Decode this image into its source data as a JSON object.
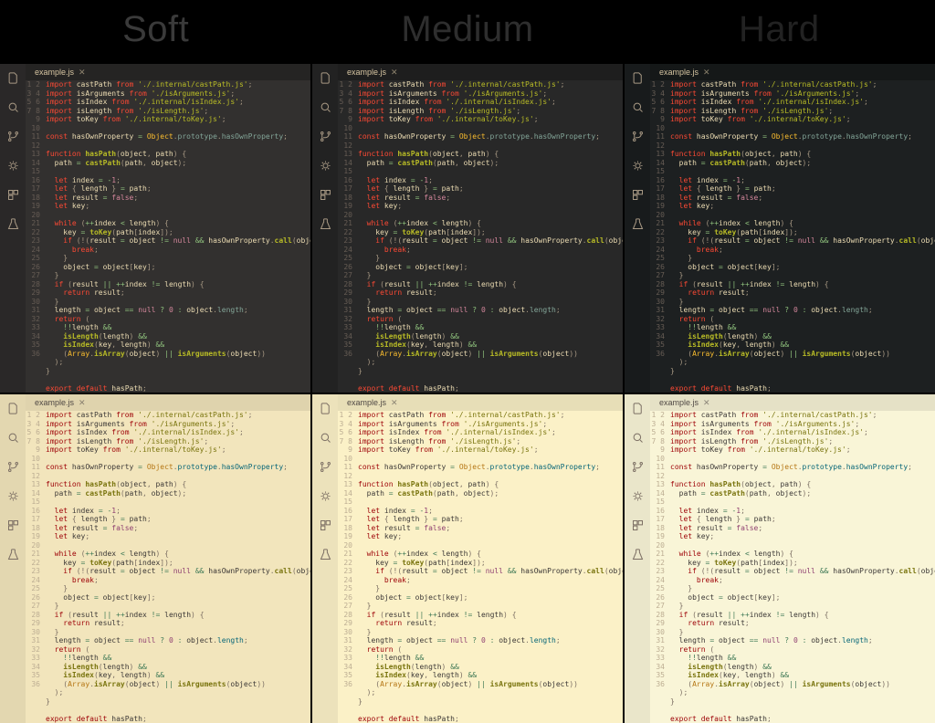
{
  "headings": {
    "soft": "Soft",
    "medium": "Medium",
    "hard": "Hard"
  },
  "tab": {
    "filename": "example.js",
    "close": "✕"
  },
  "icons": [
    "files",
    "search",
    "git-branch",
    "debug",
    "extensions",
    "testing"
  ],
  "code_lines": [
    {
      "n": 1,
      "t": [
        [
          "kw",
          "import"
        ],
        [
          "txt",
          " castPath "
        ],
        [
          "kw",
          "from"
        ],
        [
          "txt",
          " "
        ],
        [
          "str",
          "'./.internal/castPath.js'"
        ],
        [
          "pun",
          ";"
        ]
      ]
    },
    {
      "n": 2,
      "t": [
        [
          "kw",
          "import"
        ],
        [
          "txt",
          " isArguments "
        ],
        [
          "kw",
          "from"
        ],
        [
          "txt",
          " "
        ],
        [
          "str",
          "'./isArguments.js'"
        ],
        [
          "pun",
          ";"
        ]
      ]
    },
    {
      "n": 3,
      "t": [
        [
          "kw",
          "import"
        ],
        [
          "txt",
          " isIndex "
        ],
        [
          "kw",
          "from"
        ],
        [
          "txt",
          " "
        ],
        [
          "str",
          "'./.internal/isIndex.js'"
        ],
        [
          "pun",
          ";"
        ]
      ]
    },
    {
      "n": 4,
      "t": [
        [
          "kw",
          "import"
        ],
        [
          "txt",
          " isLength "
        ],
        [
          "kw",
          "from"
        ],
        [
          "txt",
          " "
        ],
        [
          "str",
          "'./isLength.js'"
        ],
        [
          "pun",
          ";"
        ]
      ]
    },
    {
      "n": 5,
      "t": [
        [
          "kw",
          "import"
        ],
        [
          "txt",
          " toKey "
        ],
        [
          "kw",
          "from"
        ],
        [
          "txt",
          " "
        ],
        [
          "str",
          "'./.internal/toKey.js'"
        ],
        [
          "pun",
          ";"
        ]
      ]
    },
    {
      "n": 6,
      "t": []
    },
    {
      "n": 7,
      "t": [
        [
          "kw",
          "const"
        ],
        [
          "txt",
          " hasOwnProperty "
        ],
        [
          "op",
          "="
        ],
        [
          "txt",
          " "
        ],
        [
          "obj",
          "Object"
        ],
        [
          "pun",
          "."
        ],
        [
          "blue",
          "prototype"
        ],
        [
          "pun",
          "."
        ],
        [
          "blue",
          "hasOwnProperty"
        ],
        [
          "pun",
          ";"
        ]
      ]
    },
    {
      "n": 8,
      "t": []
    },
    {
      "n": 9,
      "t": [
        [
          "kw",
          "function"
        ],
        [
          "txt",
          " "
        ],
        [
          "fn",
          "hasPath"
        ],
        [
          "pun",
          "("
        ],
        [
          "txt",
          "object"
        ],
        [
          "pun",
          ","
        ],
        [
          "txt",
          " path"
        ],
        [
          "pun",
          ")"
        ],
        [
          "txt",
          " "
        ],
        [
          "pun",
          "{"
        ]
      ]
    },
    {
      "n": 10,
      "t": [
        [
          "txt",
          "  path "
        ],
        [
          "op",
          "="
        ],
        [
          "txt",
          " "
        ],
        [
          "fn",
          "castPath"
        ],
        [
          "pun",
          "("
        ],
        [
          "txt",
          "path"
        ],
        [
          "pun",
          ","
        ],
        [
          "txt",
          " object"
        ],
        [
          "pun",
          ");"
        ]
      ]
    },
    {
      "n": 11,
      "t": []
    },
    {
      "n": 12,
      "t": [
        [
          "txt",
          "  "
        ],
        [
          "kw",
          "let"
        ],
        [
          "txt",
          " index "
        ],
        [
          "op",
          "="
        ],
        [
          "txt",
          " "
        ],
        [
          "op",
          "-"
        ],
        [
          "num",
          "1"
        ],
        [
          "pun",
          ";"
        ]
      ]
    },
    {
      "n": 13,
      "t": [
        [
          "txt",
          "  "
        ],
        [
          "kw",
          "let"
        ],
        [
          "txt",
          " "
        ],
        [
          "pun",
          "{"
        ],
        [
          "txt",
          " length "
        ],
        [
          "pun",
          "}"
        ],
        [
          "txt",
          " "
        ],
        [
          "op",
          "="
        ],
        [
          "txt",
          " path"
        ],
        [
          "pun",
          ";"
        ]
      ]
    },
    {
      "n": 14,
      "t": [
        [
          "txt",
          "  "
        ],
        [
          "kw",
          "let"
        ],
        [
          "txt",
          " result "
        ],
        [
          "op",
          "="
        ],
        [
          "txt",
          " "
        ],
        [
          "val",
          "false"
        ],
        [
          "pun",
          ";"
        ]
      ]
    },
    {
      "n": 15,
      "t": [
        [
          "txt",
          "  "
        ],
        [
          "kw",
          "let"
        ],
        [
          "txt",
          " key"
        ],
        [
          "pun",
          ";"
        ]
      ]
    },
    {
      "n": 16,
      "t": []
    },
    {
      "n": 17,
      "t": [
        [
          "txt",
          "  "
        ],
        [
          "kw",
          "while"
        ],
        [
          "txt",
          " "
        ],
        [
          "pun",
          "("
        ],
        [
          "op",
          "++"
        ],
        [
          "txt",
          "index "
        ],
        [
          "op",
          "<"
        ],
        [
          "txt",
          " length"
        ],
        [
          "pun",
          ")"
        ],
        [
          "txt",
          " "
        ],
        [
          "pun",
          "{"
        ]
      ]
    },
    {
      "n": 18,
      "t": [
        [
          "txt",
          "    key "
        ],
        [
          "op",
          "="
        ],
        [
          "txt",
          " "
        ],
        [
          "fn",
          "toKey"
        ],
        [
          "pun",
          "("
        ],
        [
          "txt",
          "path"
        ],
        [
          "pun",
          "["
        ],
        [
          "txt",
          "index"
        ],
        [
          "pun",
          "]);"
        ]
      ]
    },
    {
      "n": 19,
      "t": [
        [
          "txt",
          "    "
        ],
        [
          "kw",
          "if"
        ],
        [
          "txt",
          " "
        ],
        [
          "pun",
          "(!("
        ],
        [
          "txt",
          "result "
        ],
        [
          "op",
          "="
        ],
        [
          "txt",
          " object "
        ],
        [
          "op",
          "!="
        ],
        [
          "txt",
          " "
        ],
        [
          "val",
          "null"
        ],
        [
          "txt",
          " "
        ],
        [
          "op",
          "&&"
        ],
        [
          "txt",
          " hasOwnProperty"
        ],
        [
          "pun",
          "."
        ],
        [
          "fn",
          "call"
        ],
        [
          "pun",
          "("
        ],
        [
          "txt",
          "object"
        ],
        [
          "pun",
          ","
        ],
        [
          "txt",
          " key"
        ],
        [
          "pun",
          ")))"
        ],
        [
          "txt",
          " "
        ],
        [
          "pun",
          "{"
        ]
      ]
    },
    {
      "n": 20,
      "t": [
        [
          "txt",
          "      "
        ],
        [
          "kw",
          "break"
        ],
        [
          "pun",
          ";"
        ]
      ]
    },
    {
      "n": 21,
      "t": [
        [
          "txt",
          "    "
        ],
        [
          "pun",
          "}"
        ]
      ]
    },
    {
      "n": 22,
      "t": [
        [
          "txt",
          "    object "
        ],
        [
          "op",
          "="
        ],
        [
          "txt",
          " object"
        ],
        [
          "pun",
          "["
        ],
        [
          "txt",
          "key"
        ],
        [
          "pun",
          "];"
        ]
      ]
    },
    {
      "n": 23,
      "t": [
        [
          "txt",
          "  "
        ],
        [
          "pun",
          "}"
        ]
      ]
    },
    {
      "n": 24,
      "t": [
        [
          "txt",
          "  "
        ],
        [
          "kw",
          "if"
        ],
        [
          "txt",
          " "
        ],
        [
          "pun",
          "("
        ],
        [
          "txt",
          "result "
        ],
        [
          "op",
          "||"
        ],
        [
          "txt",
          " "
        ],
        [
          "op",
          "++"
        ],
        [
          "txt",
          "index "
        ],
        [
          "op",
          "!="
        ],
        [
          "txt",
          " length"
        ],
        [
          "pun",
          ")"
        ],
        [
          "txt",
          " "
        ],
        [
          "pun",
          "{"
        ]
      ]
    },
    {
      "n": 25,
      "t": [
        [
          "txt",
          "    "
        ],
        [
          "kw",
          "return"
        ],
        [
          "txt",
          " result"
        ],
        [
          "pun",
          ";"
        ]
      ]
    },
    {
      "n": 26,
      "t": [
        [
          "txt",
          "  "
        ],
        [
          "pun",
          "}"
        ]
      ]
    },
    {
      "n": 27,
      "t": [
        [
          "txt",
          "  length "
        ],
        [
          "op",
          "="
        ],
        [
          "txt",
          " object "
        ],
        [
          "op",
          "=="
        ],
        [
          "txt",
          " "
        ],
        [
          "val",
          "null"
        ],
        [
          "txt",
          " "
        ],
        [
          "op",
          "?"
        ],
        [
          "txt",
          " "
        ],
        [
          "num",
          "0"
        ],
        [
          "txt",
          " "
        ],
        [
          "op",
          ":"
        ],
        [
          "txt",
          " object"
        ],
        [
          "pun",
          "."
        ],
        [
          "blue",
          "length"
        ],
        [
          "pun",
          ";"
        ]
      ]
    },
    {
      "n": 28,
      "t": [
        [
          "txt",
          "  "
        ],
        [
          "kw",
          "return"
        ],
        [
          "txt",
          " "
        ],
        [
          "pun",
          "("
        ]
      ]
    },
    {
      "n": 29,
      "t": [
        [
          "txt",
          "    "
        ],
        [
          "op",
          "!!"
        ],
        [
          "txt",
          "length "
        ],
        [
          "op",
          "&&"
        ]
      ]
    },
    {
      "n": 30,
      "t": [
        [
          "txt",
          "    "
        ],
        [
          "fn",
          "isLength"
        ],
        [
          "pun",
          "("
        ],
        [
          "txt",
          "length"
        ],
        [
          "pun",
          ")"
        ],
        [
          "txt",
          " "
        ],
        [
          "op",
          "&&"
        ]
      ]
    },
    {
      "n": 31,
      "t": [
        [
          "txt",
          "    "
        ],
        [
          "fn",
          "isIndex"
        ],
        [
          "pun",
          "("
        ],
        [
          "txt",
          "key"
        ],
        [
          "pun",
          ","
        ],
        [
          "txt",
          " length"
        ],
        [
          "pun",
          ")"
        ],
        [
          "txt",
          " "
        ],
        [
          "op",
          "&&"
        ]
      ]
    },
    {
      "n": 32,
      "t": [
        [
          "txt",
          "    "
        ],
        [
          "pun",
          "("
        ],
        [
          "obj",
          "Array"
        ],
        [
          "pun",
          "."
        ],
        [
          "fn",
          "isArray"
        ],
        [
          "pun",
          "("
        ],
        [
          "txt",
          "object"
        ],
        [
          "pun",
          ")"
        ],
        [
          "txt",
          " "
        ],
        [
          "op",
          "||"
        ],
        [
          "txt",
          " "
        ],
        [
          "fn",
          "isArguments"
        ],
        [
          "pun",
          "("
        ],
        [
          "txt",
          "object"
        ],
        [
          "pun",
          "))"
        ]
      ]
    },
    {
      "n": 33,
      "t": [
        [
          "txt",
          "  "
        ],
        [
          "pun",
          ");"
        ]
      ]
    },
    {
      "n": 34,
      "t": [
        [
          "pun",
          "}"
        ]
      ]
    },
    {
      "n": 35,
      "t": []
    },
    {
      "n": 36,
      "t": [
        [
          "kw",
          "export"
        ],
        [
          "txt",
          " "
        ],
        [
          "kw",
          "default"
        ],
        [
          "txt",
          " hasPath"
        ],
        [
          "pun",
          ";"
        ]
      ]
    }
  ],
  "panes": [
    {
      "key": "soft-dark",
      "variant": "soft",
      "mode": "dark"
    },
    {
      "key": "medium-dark",
      "variant": "medium",
      "mode": "dark"
    },
    {
      "key": "hard-dark",
      "variant": "hard",
      "mode": "dark"
    },
    {
      "key": "soft-light",
      "variant": "soft",
      "mode": "light"
    },
    {
      "key": "medium-light",
      "variant": "medium",
      "mode": "light"
    },
    {
      "key": "hard-light",
      "variant": "hard",
      "mode": "light"
    }
  ]
}
